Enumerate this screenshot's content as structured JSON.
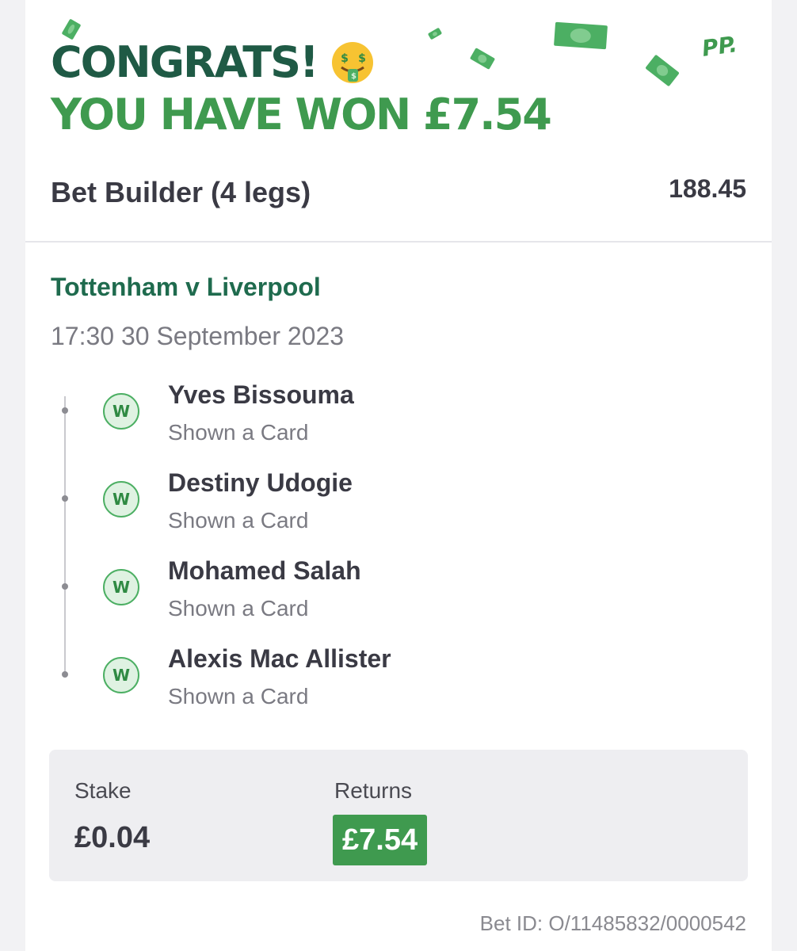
{
  "header": {
    "congrats": "CONGRATS!",
    "won_text": "YOU HAVE WON £7.54",
    "brand_mark": "PP.",
    "emoji_icon": "money-mouth-face-icon"
  },
  "bet": {
    "title": "Bet Builder (4 legs)",
    "odds": "188.45"
  },
  "match": {
    "title": "Tottenham v Liverpool",
    "datetime": "17:30 30 September 2023"
  },
  "legs": [
    {
      "status": "W",
      "name": "Yves Bissouma",
      "market": "Shown a Card"
    },
    {
      "status": "W",
      "name": "Destiny Udogie",
      "market": "Shown a Card"
    },
    {
      "status": "W",
      "name": "Mohamed Salah",
      "market": "Shown a Card"
    },
    {
      "status": "W",
      "name": "Alexis Mac Allister",
      "market": "Shown a Card"
    }
  ],
  "summary": {
    "stake_label": "Stake",
    "stake_value": "£0.04",
    "returns_label": "Returns",
    "returns_value": "£7.54"
  },
  "bet_id": "Bet ID: O/11485832/0000542",
  "colors": {
    "dark_green": "#1f5a45",
    "brand_green": "#3f9a4f",
    "win_badge_bg": "#dff2e2"
  }
}
